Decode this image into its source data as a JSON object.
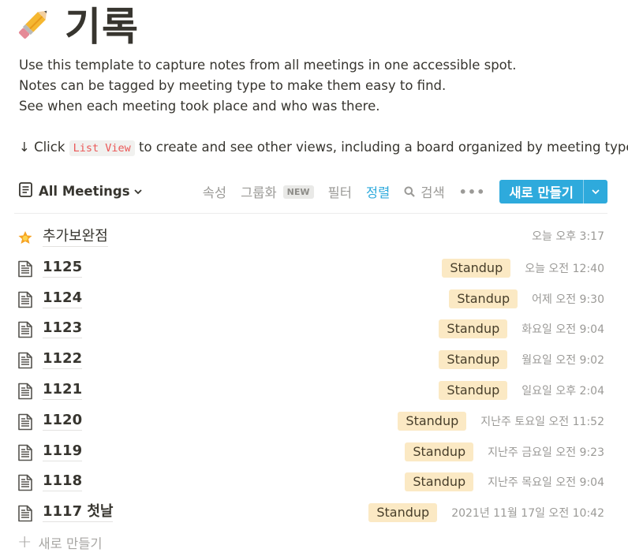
{
  "page": {
    "title": "기록",
    "title_icon": "pencil-icon",
    "description": [
      "Use this template to capture notes from all meetings in one accessible spot.",
      "Notes can be tagged by meeting type to make them easy to find.",
      "See when each meeting took place and who was there."
    ],
    "click_prefix": "↓ Click",
    "click_code": "List View",
    "click_suffix": "to create and see other views, including a board organized by meeting type."
  },
  "toolbar": {
    "view_icon": "list-view-icon",
    "view_label": "All Meetings",
    "properties": "속성",
    "group": "그룹화",
    "group_badge": "NEW",
    "filter": "필터",
    "sort": "정렬",
    "search": "검색",
    "more": "•••",
    "new_button": "새로 만들기",
    "accent_color": "#2eaadc"
  },
  "rows": [
    {
      "icon": "star-icon",
      "name": "추가보완점",
      "tag": "",
      "date": "오늘 오후 3:17"
    },
    {
      "icon": "page-icon",
      "name": "1125",
      "tag": "Standup",
      "date": "오늘 오전 12:40"
    },
    {
      "icon": "page-icon",
      "name": "1124",
      "tag": "Standup",
      "date": "어제 오전 9:30"
    },
    {
      "icon": "page-icon",
      "name": "1123",
      "tag": "Standup",
      "date": "화요일 오전 9:04"
    },
    {
      "icon": "page-icon",
      "name": "1122",
      "tag": "Standup",
      "date": "월요일 오전 9:02"
    },
    {
      "icon": "page-icon",
      "name": "1121",
      "tag": "Standup",
      "date": "일요일 오후 2:04"
    },
    {
      "icon": "page-icon",
      "name": "1120",
      "tag": "Standup",
      "date": "지난주 토요일 오전 11:52"
    },
    {
      "icon": "page-icon",
      "name": "1119",
      "tag": "Standup",
      "date": "지난주 금요일 오전 9:23"
    },
    {
      "icon": "page-icon",
      "name": "1118",
      "tag": "Standup",
      "date": "지난주 목요일 오전 9:04"
    },
    {
      "icon": "page-icon",
      "name": "1117 첫날",
      "tag": "Standup",
      "date": "2021년 11월 17일 오전 10:42"
    }
  ],
  "add_row": {
    "plus": "+",
    "label": "새로 만들기"
  },
  "colors": {
    "tag_bg": "#fbe9c4",
    "text": "#37352f",
    "muted": "#9b9a97"
  }
}
